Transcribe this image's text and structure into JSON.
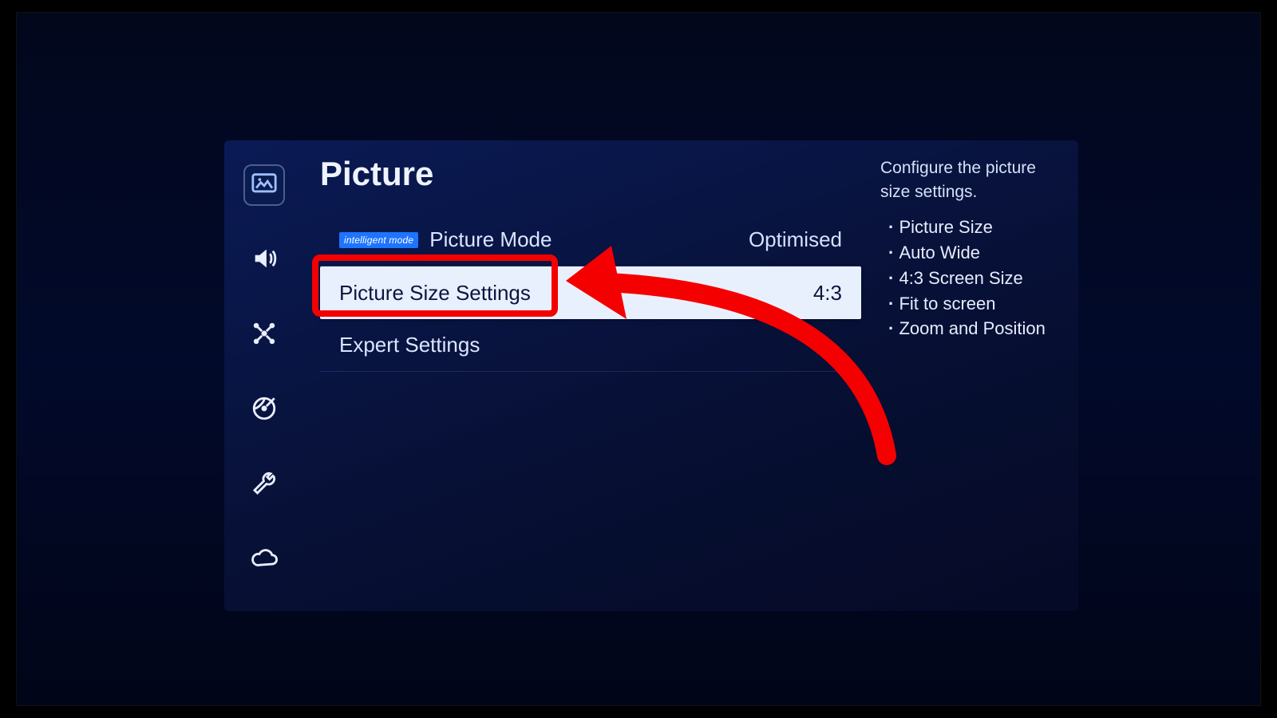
{
  "title": "Picture",
  "sidebar": {
    "active_index": 0,
    "items": [
      "picture",
      "sound",
      "network",
      "broadcast",
      "system",
      "support"
    ]
  },
  "rows": {
    "mode": {
      "badge": "intelligent mode",
      "label": "Picture Mode",
      "value": "Optimised"
    },
    "size": {
      "label": "Picture Size Settings",
      "value": "4:3"
    },
    "expert": {
      "label": "Expert Settings"
    }
  },
  "help": {
    "description": "Configure the picture size settings.",
    "items": [
      "Picture Size",
      "Auto Wide",
      "4:3 Screen Size",
      "Fit to screen",
      "Zoom and Position"
    ]
  },
  "annotation": {
    "color": "#f40000",
    "target": "picture-size-settings-row"
  }
}
